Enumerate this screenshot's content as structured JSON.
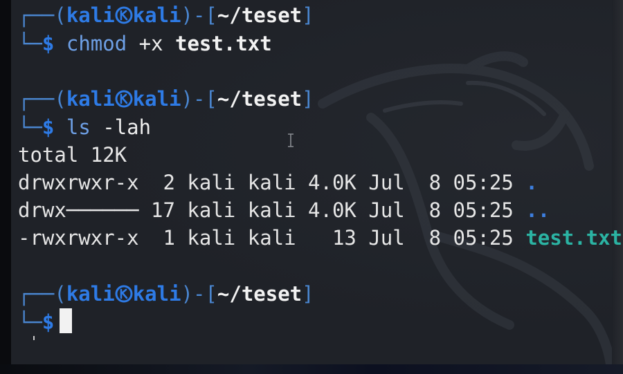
{
  "prompt": {
    "user": "kali",
    "host": "kali",
    "path": "~/teset",
    "prefix_top": "┌──(",
    "sep_close": ")-[",
    "bracket_close": "]",
    "prefix_bottom": "└─",
    "dollar": "$"
  },
  "blocks": [
    {
      "command": "chmod",
      "args_plain": " +x ",
      "args_bold": "test.txt"
    },
    {
      "command": "ls",
      "args_plain": " -lah",
      "args_bold": ""
    },
    {
      "command": "",
      "args_plain": "",
      "args_bold": ""
    }
  ],
  "ls_output": {
    "total": "total 12K",
    "rows": [
      {
        "text": "drwxrwxr-x  2 kali kali 4.0K Jul  8 05:25 ",
        "name": ".",
        "kind": "dir"
      },
      {
        "text": "drwx────── 17 kali kali 4.0K Jul  8 05:25 ",
        "name": "..",
        "kind": "dir"
      },
      {
        "text": "-rwxrwxr-x  1 kali kali   13 Jul  8 05:25 ",
        "name": "test.txt",
        "kind": "exec"
      }
    ]
  },
  "colors": {
    "terminal_bg": "#1f2228",
    "prompt_blue": "#2e7be6",
    "exec_teal": "#2bb3a3",
    "dir_blue": "#3d7fe0"
  },
  "icons": {
    "user_host_separator": "kali-at-icon",
    "background_logo": "kali-dragon-icon",
    "mouse_pointer": "text-ibeam-cursor-icon"
  }
}
